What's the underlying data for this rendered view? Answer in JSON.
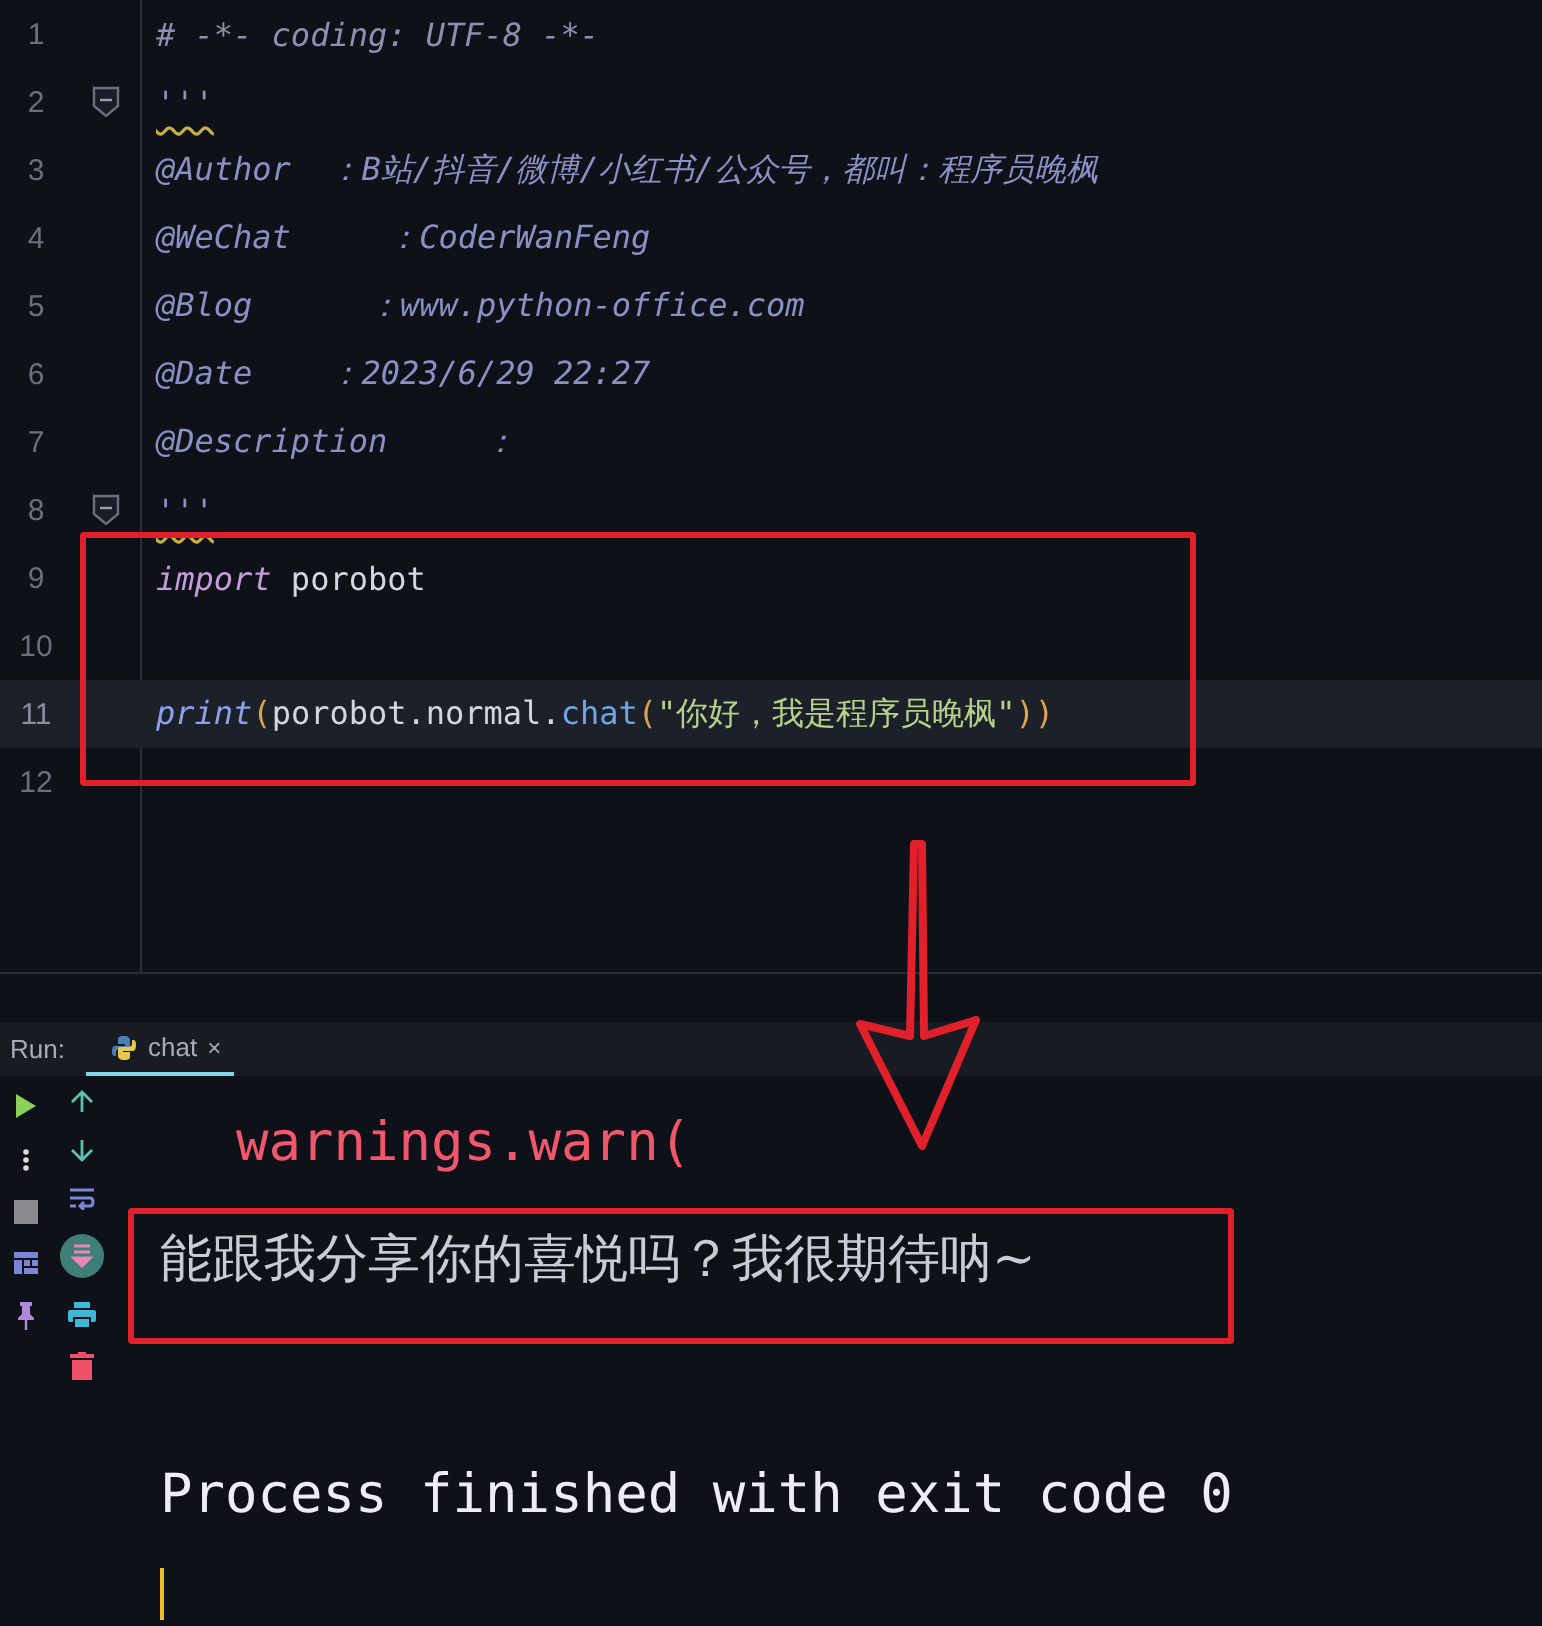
{
  "editor": {
    "lines": [
      {
        "number": "1",
        "current": false,
        "tokens": [
          {
            "kind": "comment",
            "text": "# -*- coding: UTF-8 -*-"
          }
        ]
      },
      {
        "number": "2",
        "current": false,
        "fold": true,
        "tokens": [
          {
            "kind": "doc",
            "text": "'''",
            "warning": true
          }
        ]
      },
      {
        "number": "3",
        "current": false,
        "tokens": [
          {
            "kind": "doc",
            "text": "@Author  ：B站/抖音/微博/小红书/公众号，都叫：程序员晚枫"
          }
        ]
      },
      {
        "number": "4",
        "current": false,
        "tokens": [
          {
            "kind": "doc",
            "text": "@WeChat     ：CoderWanFeng"
          }
        ]
      },
      {
        "number": "5",
        "current": false,
        "tokens": [
          {
            "kind": "doc",
            "text": "@Blog      ：www.python-office.com"
          }
        ]
      },
      {
        "number": "6",
        "current": false,
        "tokens": [
          {
            "kind": "doc",
            "text": "@Date    ：2023/6/29 22:27"
          }
        ]
      },
      {
        "number": "7",
        "current": false,
        "tokens": [
          {
            "kind": "doc",
            "text": "@Description     ："
          }
        ]
      },
      {
        "number": "8",
        "current": false,
        "fold": true,
        "tokens": [
          {
            "kind": "doc",
            "text": "'''",
            "warning": true
          }
        ]
      },
      {
        "number": "9",
        "current": false,
        "tokens": [
          {
            "kind": "keyword",
            "text": "import"
          },
          {
            "kind": "plain",
            "text": " porobot"
          }
        ]
      },
      {
        "number": "10",
        "current": false
      },
      {
        "number": "11",
        "current": true,
        "tokens": [
          {
            "kind": "builtin",
            "text": "print"
          },
          {
            "kind": "paren",
            "text": "("
          },
          {
            "kind": "plain",
            "text": "porobot.normal."
          },
          {
            "kind": "method",
            "text": "chat"
          },
          {
            "kind": "paren",
            "text": "("
          },
          {
            "kind": "string",
            "text": "\"你好，我是程序员晚枫\""
          },
          {
            "kind": "paren",
            "text": "))"
          }
        ]
      },
      {
        "number": "12",
        "current": false
      }
    ]
  },
  "run_panel": {
    "label": "Run:",
    "tabs": [
      {
        "label": "chat",
        "selected": true,
        "close": "×"
      }
    ],
    "console": [
      {
        "kind": "warning",
        "text": "warnings.warn("
      },
      {
        "kind": "output",
        "text": "能跟我分享你的喜悦吗？我很期待呐~"
      },
      {
        "kind": "exit",
        "text": "Process finished with exit code 0"
      },
      {
        "kind": "cursor"
      }
    ]
  }
}
